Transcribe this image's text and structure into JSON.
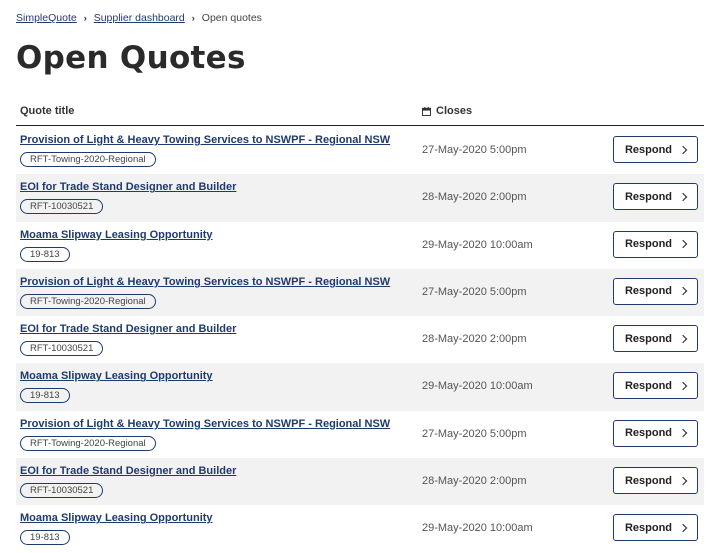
{
  "breadcrumb": {
    "items": [
      "SimpleQuote",
      "Supplier dashboard"
    ],
    "current": "Open quotes"
  },
  "page_title": "Open Quotes",
  "table": {
    "columns": {
      "title": "Quote title",
      "closes": "Closes"
    },
    "respond_label": "Respond",
    "rows": [
      {
        "title": "Provision of Light & Heavy Towing Services to NSWPF - Regional NSW",
        "ref": "RFT-Towing-2020-Regional",
        "closes": "27-May-2020 5:00pm"
      },
      {
        "title": "EOI for Trade Stand Designer and Builder",
        "ref": "RFT-10030521",
        "closes": "28-May-2020 2:00pm"
      },
      {
        "title": "Moama Slipway Leasing Opportunity",
        "ref": "19-813",
        "closes": "29-May-2020 10:00am"
      },
      {
        "title": "Provision of Light & Heavy Towing Services to NSWPF - Regional NSW",
        "ref": "RFT-Towing-2020-Regional",
        "closes": "27-May-2020 5:00pm"
      },
      {
        "title": "EOI for Trade Stand Designer and Builder",
        "ref": "RFT-10030521",
        "closes": "28-May-2020 2:00pm"
      },
      {
        "title": "Moama Slipway Leasing Opportunity",
        "ref": "19-813",
        "closes": "29-May-2020 10:00am"
      },
      {
        "title": "Provision of Light & Heavy Towing Services to NSWPF - Regional NSW",
        "ref": "RFT-Towing-2020-Regional",
        "closes": "27-May-2020 5:00pm"
      },
      {
        "title": "EOI for Trade Stand Designer and Builder",
        "ref": "RFT-10030521",
        "closes": "28-May-2020 2:00pm"
      },
      {
        "title": "Moama Slipway Leasing Opportunity",
        "ref": "19-813",
        "closes": "29-May-2020 10:00am"
      }
    ]
  },
  "icons": {
    "closes_header": "calendar-icon",
    "respond": "chevron-right-icon"
  },
  "colors": {
    "link": "#1f3a6e",
    "alt_row": "#f2f2f2",
    "text": "#222222"
  }
}
